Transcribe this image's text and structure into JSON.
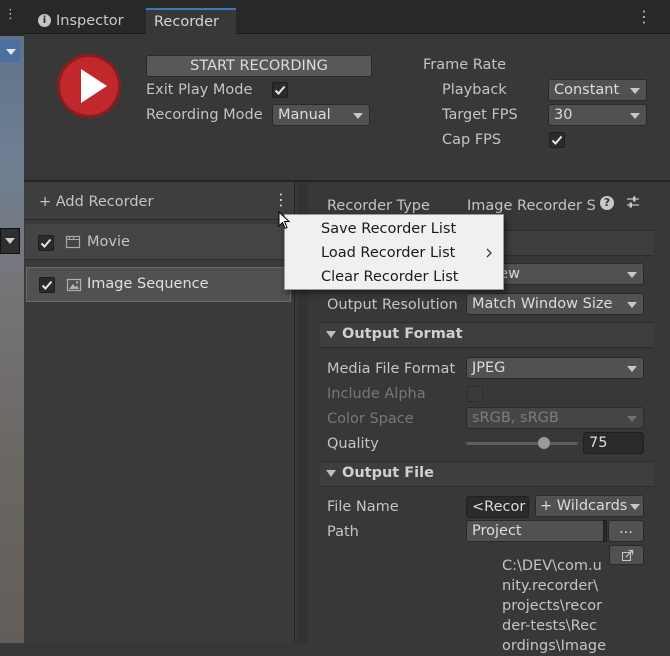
{
  "tabs": [
    {
      "label": "Inspector",
      "active": false
    },
    {
      "label": "Recorder",
      "active": true
    }
  ],
  "recording": {
    "start_label": "START RECORDING",
    "exit_play_mode_label": "Exit Play Mode",
    "exit_play_mode_checked": true,
    "recording_mode_label": "Recording Mode",
    "recording_mode_value": "Manual"
  },
  "frame_rate": {
    "title": "Frame Rate",
    "playback_label": "Playback",
    "playback_value": "Constant",
    "target_fps_label": "Target FPS",
    "target_fps_value": "30",
    "cap_fps_label": "Cap FPS",
    "cap_fps_checked": true
  },
  "recorder_list": {
    "add_label": "+ Add Recorder",
    "items": [
      {
        "label": "Movie",
        "checked": true,
        "icon": "movie-icon",
        "selected": false
      },
      {
        "label": "Image Sequence",
        "checked": true,
        "icon": "image-icon",
        "selected": true
      }
    ]
  },
  "context_menu": {
    "items": [
      {
        "label": "Save Recorder List",
        "has_submenu": false
      },
      {
        "label": "Load Recorder List",
        "has_submenu": true
      },
      {
        "label": "Clear Recorder List",
        "has_submenu": false
      }
    ]
  },
  "inspector": {
    "recorder_type_label": "Recorder Type",
    "recorder_type_value": "Image Recorder S",
    "source_value": "e View",
    "output_resolution_label": "Output Resolution",
    "output_resolution_value": "Match Window Size",
    "output_format": {
      "header": "Output Format",
      "media_format_label": "Media File Format",
      "media_format_value": "JPEG",
      "include_alpha_label": "Include Alpha",
      "color_space_label": "Color Space",
      "color_space_value": "sRGB, sRGB",
      "quality_label": "Quality",
      "quality_value": "75",
      "quality_fraction": 0.78
    },
    "output_file": {
      "header": "Output File",
      "file_name_label": "File Name",
      "file_name_value": "<Recor",
      "wildcards_label": "+ Wildcards",
      "path_label": "Path",
      "path_value": "Project",
      "browse_label": "...",
      "path_lines": [
        "C:\\DEV\\com.u",
        "nity.recorder\\",
        "projects\\recor",
        "der-tests\\Rec",
        "ordings\\Image"
      ]
    }
  },
  "colors": {
    "accent_tab": "#3a79bb",
    "record_button": "#c0282c"
  }
}
